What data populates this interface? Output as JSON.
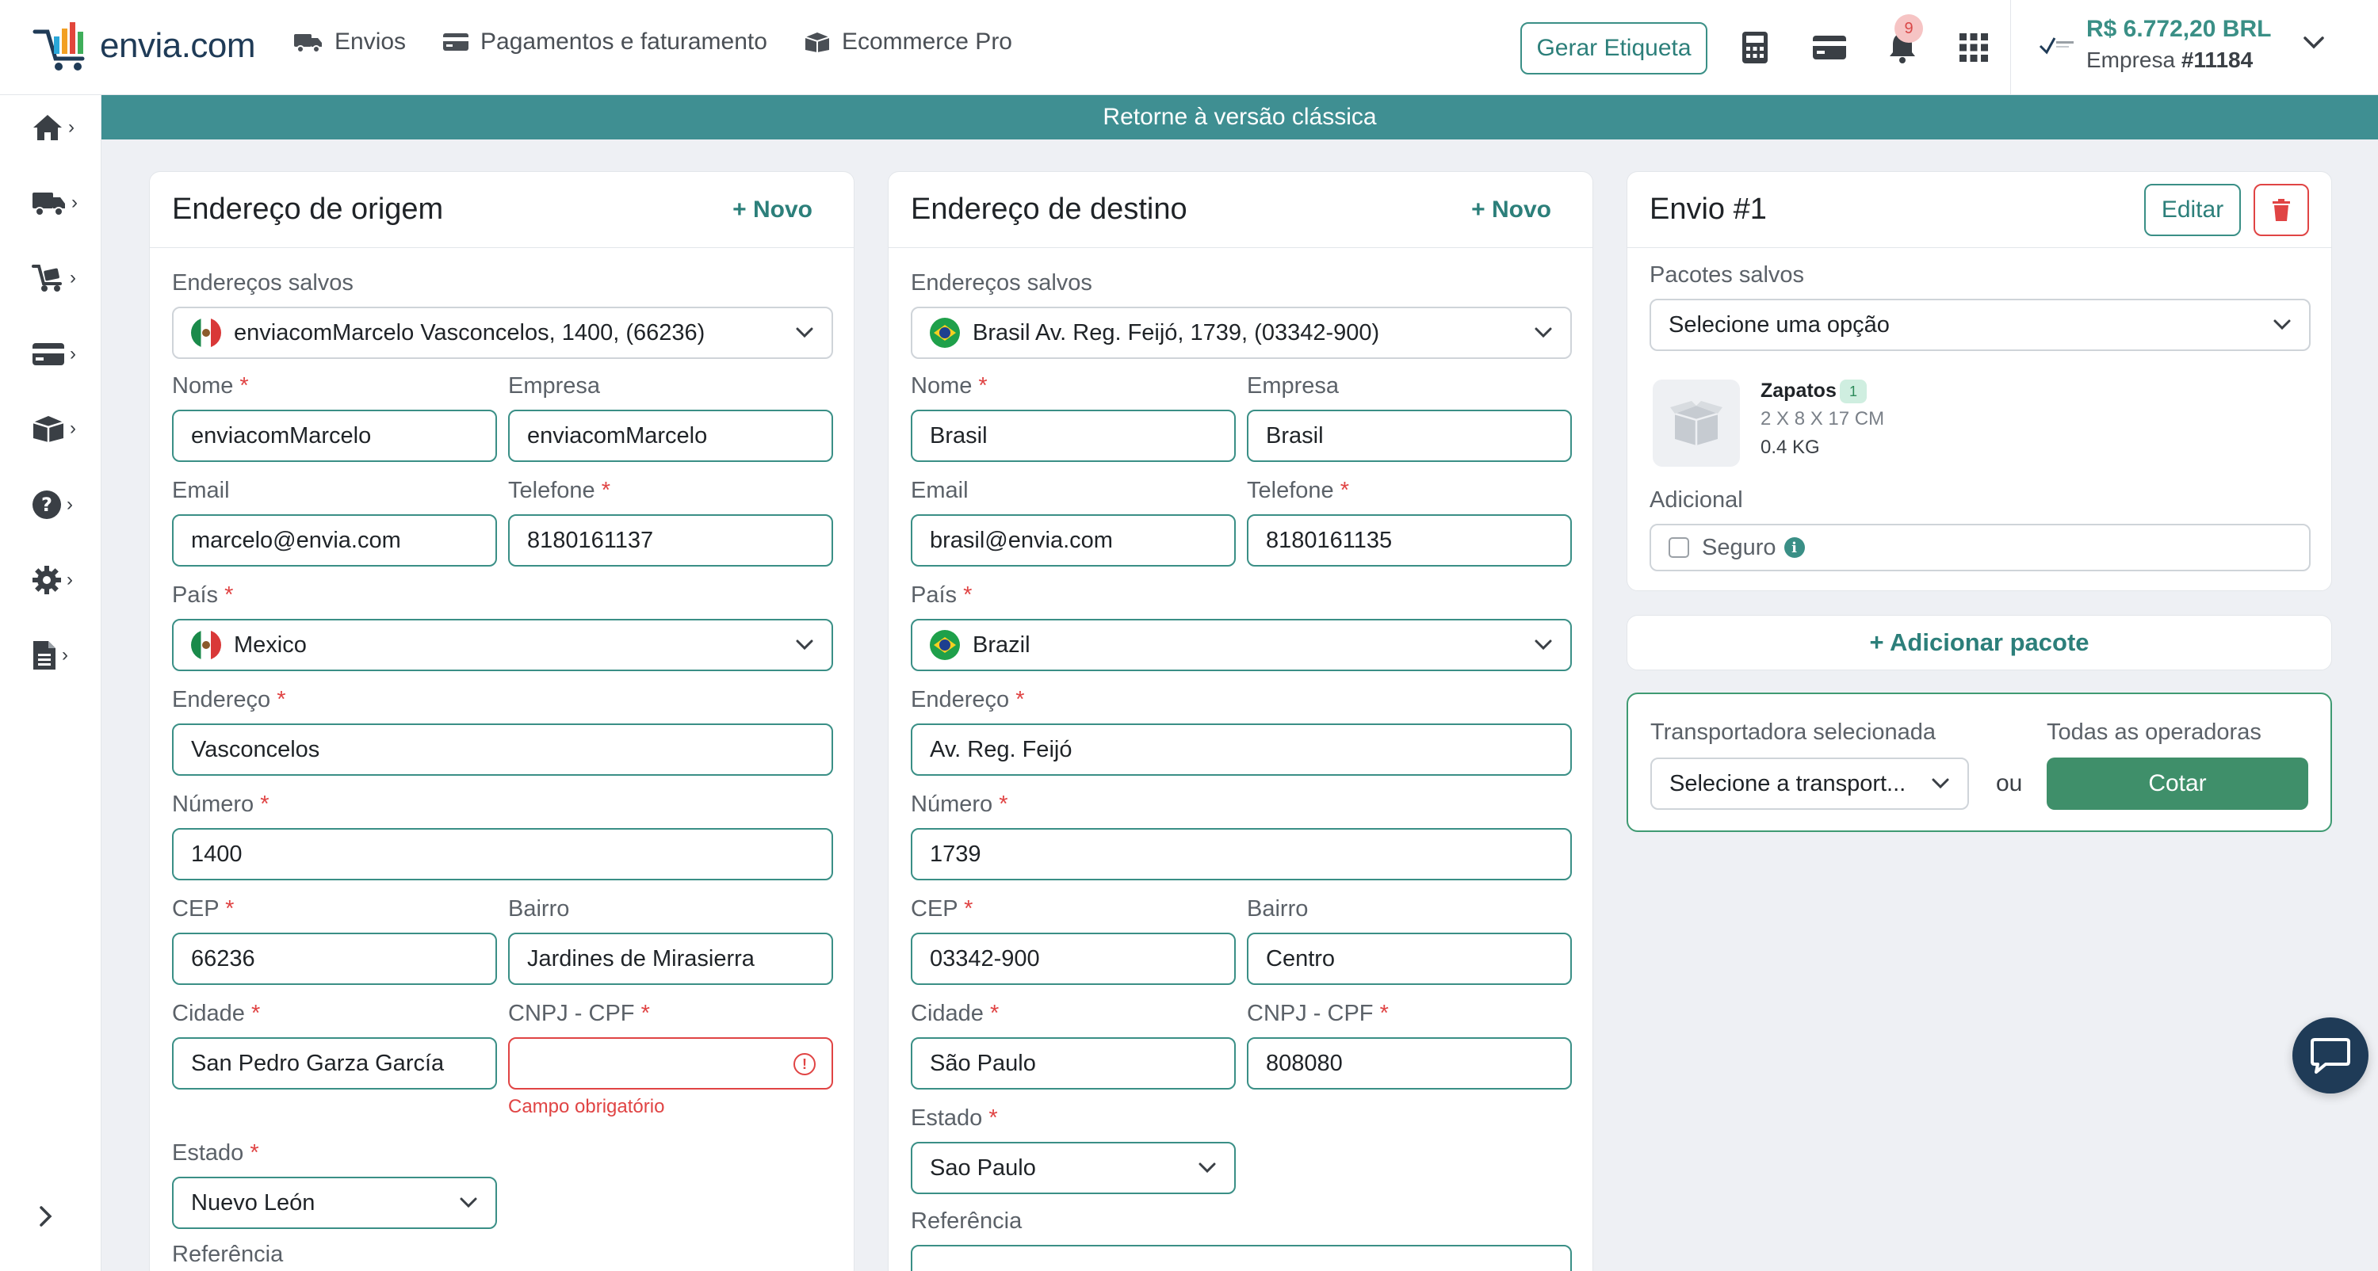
{
  "brand": {
    "name": "envia.com"
  },
  "nav": {
    "items": [
      {
        "label": "Envios",
        "icon": "truck-icon"
      },
      {
        "label": "Pagamentos e faturamento",
        "icon": "credit-card-icon"
      },
      {
        "label": "Ecommerce Pro",
        "icon": "box-icon"
      }
    ]
  },
  "header": {
    "generate_label": "Gerar Etiqueta",
    "notifications_count": "9",
    "balance": "R$ 6.772,20 BRL",
    "company_prefix": "Empresa ",
    "company_id": "#11184"
  },
  "sidebar": {
    "items": [
      {
        "icon": "home-icon"
      },
      {
        "icon": "truck-icon"
      },
      {
        "icon": "cart-icon"
      },
      {
        "icon": "credit-card-icon"
      },
      {
        "icon": "box-icon"
      },
      {
        "icon": "help-icon"
      },
      {
        "icon": "gear-icon"
      },
      {
        "icon": "document-icon"
      }
    ]
  },
  "banner": {
    "text": "Retorne à versão clássica"
  },
  "origin": {
    "title": "Endereço de origem",
    "new_label": "+ Novo",
    "saved_label": "Endereços salvos",
    "saved_value": "enviacomMarcelo Vasconcelos, 1400, (66236)",
    "name_label": "Nome",
    "name_value": "enviacomMarcelo",
    "company_label": "Empresa",
    "company_value": "enviacomMarcelo",
    "email_label": "Email",
    "email_value": "marcelo@envia.com",
    "phone_label": "Telefone",
    "phone_value": "8180161137",
    "country_label": "País",
    "country_value": "Mexico",
    "address_label": "Endereço",
    "address_value": "Vasconcelos",
    "number_label": "Número",
    "number_value": "1400",
    "cep_label": "CEP",
    "cep_value": "66236",
    "district_label": "Bairro",
    "district_value": "Jardines de Mirasierra",
    "city_label": "Cidade",
    "city_value": "San Pedro Garza García",
    "tax_label": "CNPJ - CPF",
    "tax_value": "",
    "tax_error": "Campo obrigatório",
    "state_label": "Estado",
    "state_value": "Nuevo León",
    "reference_label": "Referência",
    "required_mark": "*"
  },
  "destination": {
    "title": "Endereço de destino",
    "new_label": "+ Novo",
    "saved_label": "Endereços salvos",
    "saved_value": "Brasil Av. Reg. Feijó, 1739, (03342-900)",
    "name_label": "Nome",
    "name_value": "Brasil",
    "company_label": "Empresa",
    "company_value": "Brasil",
    "email_label": "Email",
    "email_value": "brasil@envia.com",
    "phone_label": "Telefone",
    "phone_value": "8180161135",
    "country_label": "País",
    "country_value": "Brazil",
    "address_label": "Endereço",
    "address_value": "Av. Reg. Feijó",
    "number_label": "Número",
    "number_value": "1739",
    "cep_label": "CEP",
    "cep_value": "03342-900",
    "district_label": "Bairro",
    "district_value": "Centro",
    "city_label": "Cidade",
    "city_value": "São Paulo",
    "tax_label": "CNPJ - CPF",
    "tax_value": "808080",
    "state_label": "Estado",
    "state_value": "Sao Paulo",
    "reference_label": "Referência",
    "required_mark": "*"
  },
  "shipment": {
    "title": "Envio #1",
    "edit_label": "Editar",
    "packages_label": "Pacotes salvos",
    "packages_value": "Selecione uma opção",
    "package_name": "Zapatos",
    "package_count": "1",
    "package_dims": "2 X 8 X 17 CM",
    "package_weight": "0.4 KG",
    "additional_label": "Adicional",
    "insurance_label": "Seguro",
    "add_package_label": "+ Adicionar pacote",
    "carrier_label": "Transportadora selecionada",
    "carrier_placeholder": "Selecione a transport...",
    "or_label": "ou",
    "all_operators_label": "Todas as operadoras",
    "quote_label": "Cotar"
  },
  "colors": {
    "accent": "#3a8f86",
    "banner": "#3f8f92",
    "error": "#e04444",
    "primary_button": "#3f8f6a"
  }
}
